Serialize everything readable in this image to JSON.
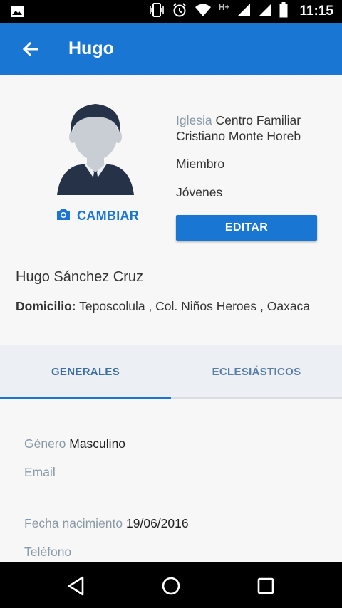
{
  "status_bar": {
    "time": "11:15",
    "network_label": "H+",
    "icons": [
      "image-icon",
      "vibrate-icon",
      "alarm-icon",
      "wifi-icon",
      "signal-icon",
      "signal-icon",
      "battery-icon"
    ]
  },
  "app_bar": {
    "title": "Hugo",
    "back_icon": "arrow-back-icon"
  },
  "profile": {
    "change_photo_label": "CAMBIAR",
    "church_label": "Iglesia",
    "church_name": "Centro Familiar Cristiano Monte Horeb",
    "role": "Miembro",
    "group": "Jóvenes",
    "edit_label": "EDITAR",
    "full_name": "Hugo Sánchez Cruz",
    "address_label": "Domicilio:",
    "address_value": "Teposcolula , Col. Niños Heroes , Oaxaca"
  },
  "tabs": [
    {
      "label": "GENERALES",
      "active": true
    },
    {
      "label": "ECLESIÁSTICOS",
      "active": false
    }
  ],
  "details": {
    "gender_label": "Género",
    "gender_value": "Masculino",
    "email_label": "Email",
    "email_value": "",
    "birth_label": "Fecha nacimiento",
    "birth_value": "19/06/2016",
    "phone_label": "Teléfono",
    "phone_value": ""
  },
  "colors": {
    "primary": "#1976d2",
    "label_gray": "#8a99a8",
    "tab_bg": "#eceff3"
  }
}
